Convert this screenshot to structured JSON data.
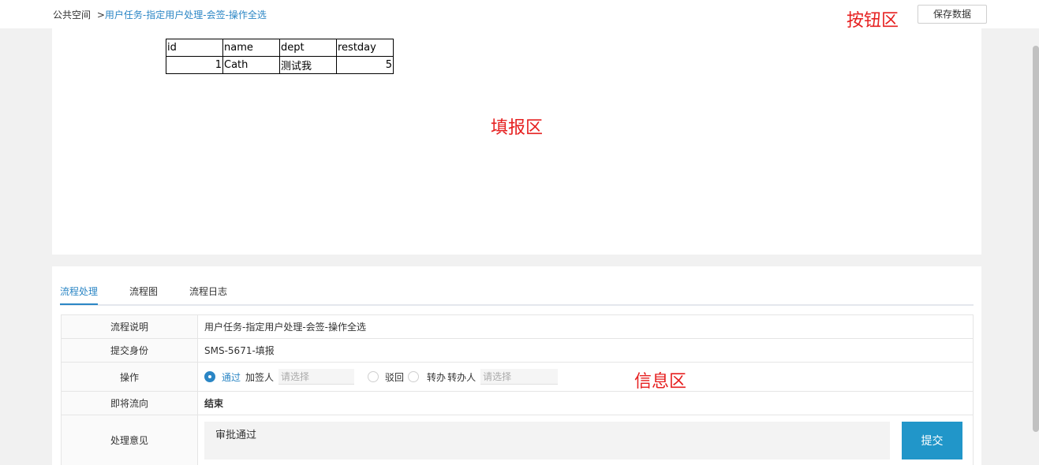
{
  "breadcrumb": {
    "root": "公共空间",
    "separator": ">",
    "current": "用户任务-指定用户处理-会签-操作全选"
  },
  "toolbar": {
    "zone_label": "按钮区",
    "save_label": "保存数据"
  },
  "fill_area": {
    "zone_label": "填报区",
    "table": {
      "headers": [
        "id",
        "name",
        "dept",
        "restday"
      ],
      "rows": [
        [
          "1",
          "Cath",
          "测试我",
          "5"
        ]
      ]
    }
  },
  "info_area": {
    "zone_label": "信息区",
    "tabs": [
      {
        "label": "流程处理",
        "active": true
      },
      {
        "label": "流程图",
        "active": false
      },
      {
        "label": "流程日志",
        "active": false
      }
    ],
    "rows": {
      "description_label": "流程说明",
      "description_value": "用户任务-指定用户处理-会签-操作全选",
      "submitter_label": "提交身份",
      "submitter_value": "SMS-5671-填报",
      "operation_label": "操作",
      "operation": {
        "approve": "通过",
        "add_signer": "加签人",
        "add_signer_placeholder": "请选择",
        "reject": "驳回",
        "transfer": "转办",
        "transfer_person": "转办人",
        "transfer_placeholder": "请选择",
        "selected": "通过"
      },
      "next_label": "即将流向",
      "next_value": "结束",
      "opinion_label": "处理意见",
      "opinion_value": "审批通过"
    },
    "submit_label": "提交"
  },
  "colors": {
    "accent": "#2b86c5",
    "submit_button": "#2196c9",
    "zone_label": "#e62020"
  }
}
